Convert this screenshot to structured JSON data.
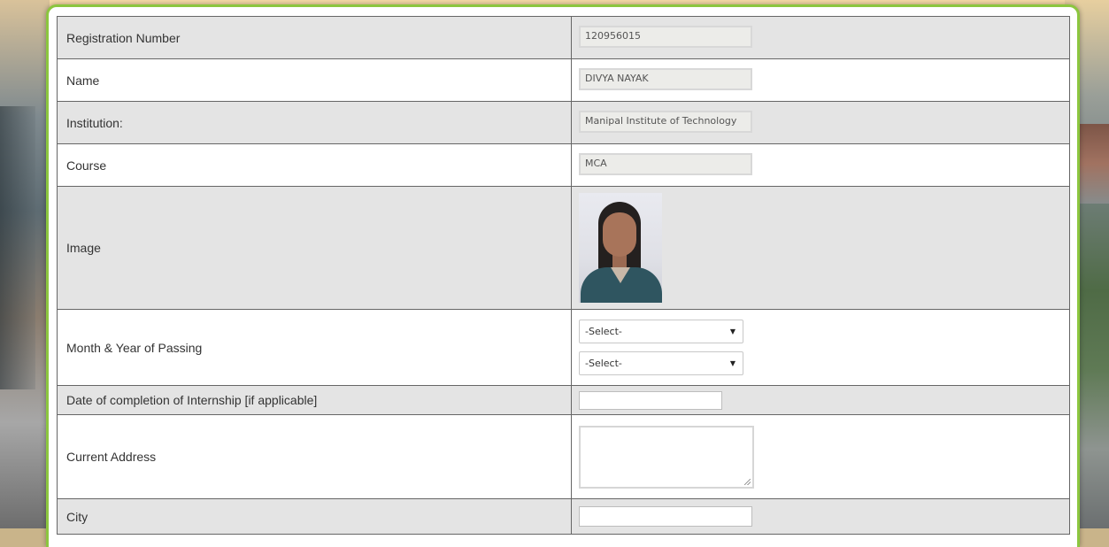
{
  "form": {
    "rows": [
      {
        "label": "Registration Number",
        "value": "120956015"
      },
      {
        "label": "Name",
        "value": "DIVYA NAYAK"
      },
      {
        "label": "Institution:",
        "value": "Manipal Institute of Technology"
      },
      {
        "label": "Course",
        "value": "MCA"
      },
      {
        "label": "Image"
      },
      {
        "label": "Month & Year of Passing",
        "month_selected": "-Select-",
        "year_selected": "-Select-"
      },
      {
        "label": "Date of completion of Internship [if applicable]",
        "value": ""
      },
      {
        "label": "Current Address",
        "value": ""
      },
      {
        "label": "City",
        "value": ""
      }
    ]
  },
  "colors": {
    "panel_border": "#8cc63f",
    "row_alt": "#e4e4e4",
    "row_plain": "#ffffff",
    "readonly_input_bg": "#ecece9"
  },
  "icons": {
    "dropdown": "caret-down-icon"
  }
}
